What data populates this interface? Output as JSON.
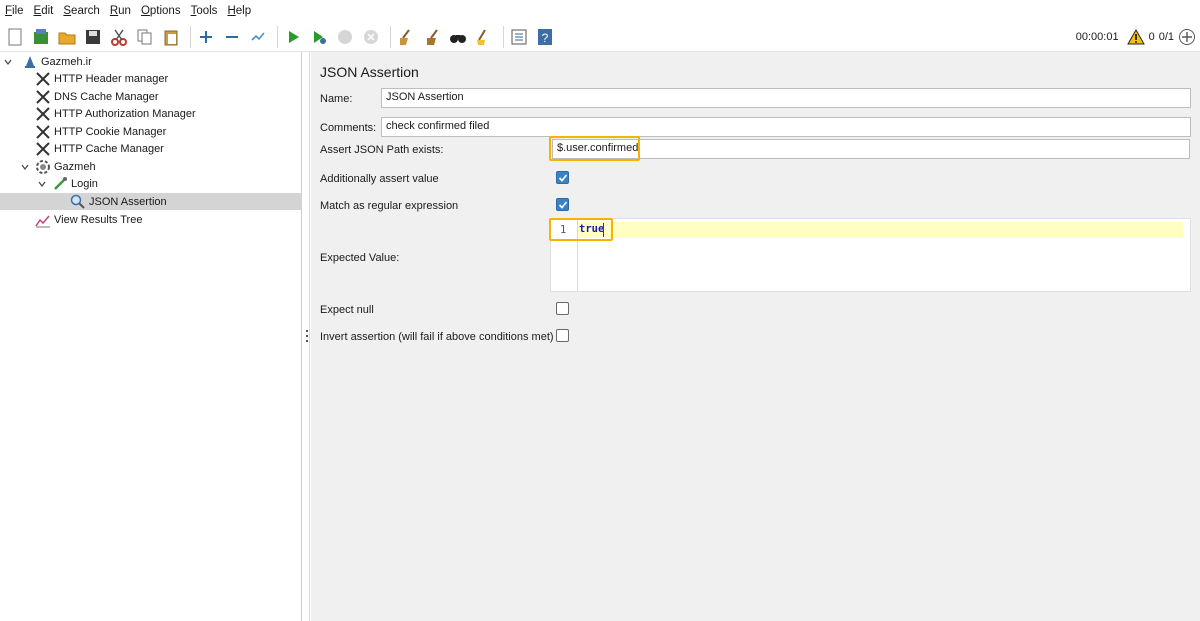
{
  "menu": [
    {
      "mnemonic": "F",
      "rest": "ile"
    },
    {
      "mnemonic": "E",
      "rest": "dit"
    },
    {
      "mnemonic": "S",
      "rest": "earch"
    },
    {
      "mnemonic": "R",
      "rest": "un"
    },
    {
      "mnemonic": "O",
      "rest": "ptions"
    },
    {
      "mnemonic": "T",
      "rest": "ools"
    },
    {
      "mnemonic": "H",
      "rest": "elp"
    }
  ],
  "status": {
    "elapsed": "00:00:01",
    "warnings": "0",
    "threads": "0/1"
  },
  "tree": {
    "root": "Gazmeh.ir",
    "items": [
      {
        "label": "HTTP Header manager"
      },
      {
        "label": "DNS Cache Manager"
      },
      {
        "label": "HTTP Authorization Manager"
      },
      {
        "label": "HTTP Cookie Manager"
      },
      {
        "label": "HTTP Cache Manager"
      },
      {
        "label": "Gazmeh"
      },
      {
        "label": "Login"
      },
      {
        "label": "JSON Assertion"
      },
      {
        "label": "View Results Tree"
      }
    ]
  },
  "form": {
    "title": "JSON Assertion",
    "name_label": "Name:",
    "name_value": "JSON Assertion",
    "comments_label": "Comments:",
    "comments_value": "check confirmed filed",
    "path_label": "Assert JSON Path exists:",
    "path_value": "$.user.confirmed",
    "assert_value_label": "Additionally assert value",
    "assert_value_checked": true,
    "regex_label": "Match as regular expression",
    "regex_checked": true,
    "expected_label": "Expected Value:",
    "expected_line_number": "1",
    "expected_code": "true",
    "expect_null_label": "Expect null",
    "expect_null_checked": false,
    "invert_label": "Invert assertion (will fail if above conditions met)",
    "invert_checked": false
  },
  "colors": {
    "highlight": "#f4b400",
    "checkbox_checked": "#3b82c4",
    "editor_line": "#ffffc4"
  }
}
